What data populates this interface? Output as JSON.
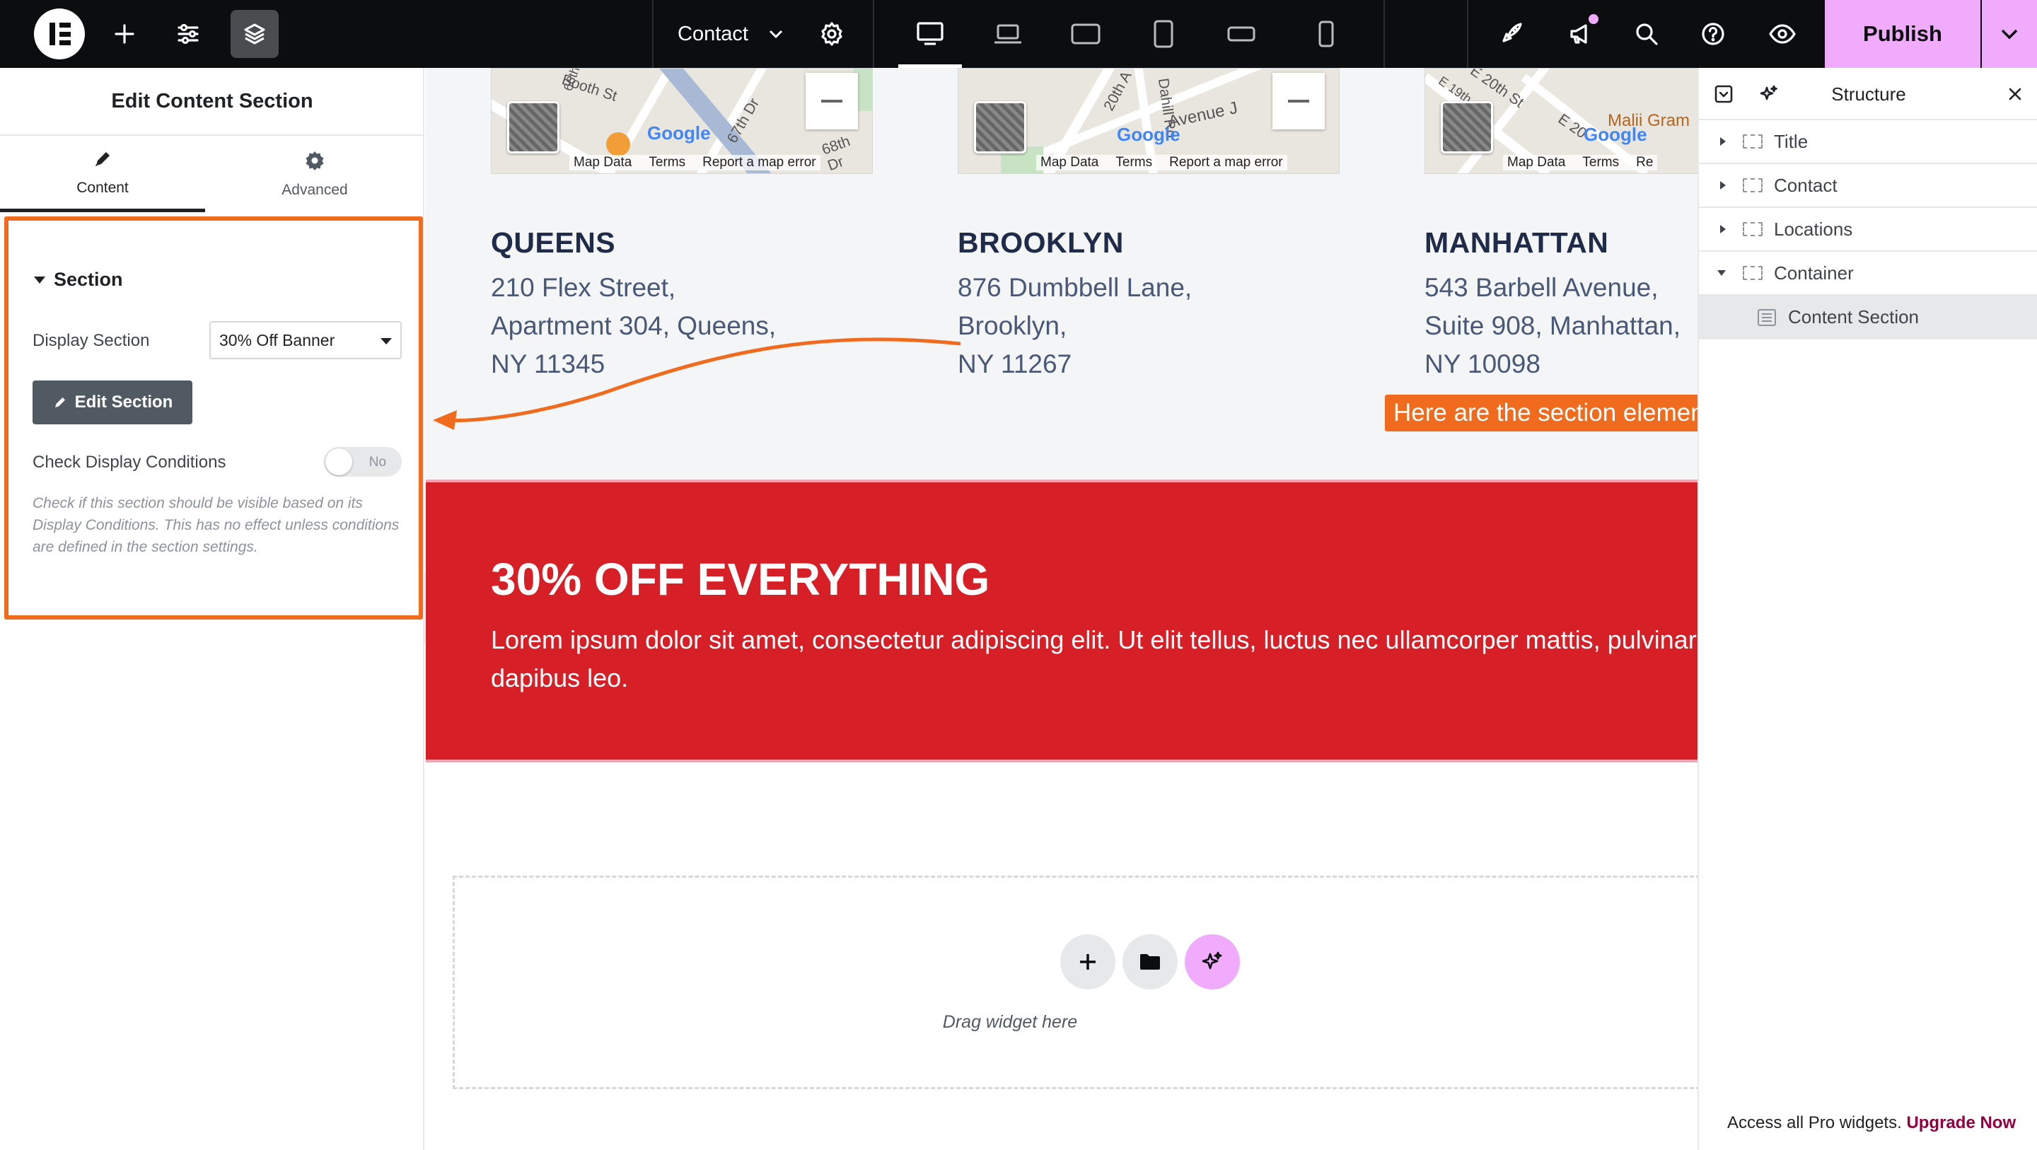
{
  "topbar": {
    "document_title": "Contact",
    "publish_label": "Publish",
    "icons": [
      "elementor-logo-icon",
      "add-icon",
      "settings-sliders-icon",
      "layers-icon",
      "chevron-down-icon",
      "gear-icon",
      "desktop-icon",
      "laptop-icon",
      "tablet-landscape-icon",
      "tablet-portrait-icon",
      "mobile-landscape-icon",
      "mobile-portrait-icon",
      "rocket-icon",
      "megaphone-icon",
      "search-icon",
      "help-icon",
      "eye-icon"
    ]
  },
  "left_panel": {
    "title": "Edit Content Section",
    "tabs": [
      {
        "label": "Content",
        "icon": "pencil-icon",
        "active": true
      },
      {
        "label": "Advanced",
        "icon": "gear-icon",
        "active": false
      }
    ],
    "section": {
      "heading": "Section",
      "display_section_label": "Display Section",
      "display_section_value": "30% Off Banner",
      "edit_button_label": "Edit Section",
      "check_conditions_label": "Check Display Conditions",
      "toggle_value": "No",
      "help_text": "Check if this section should be visible based on its Display Conditions. This has no effect unless conditions are defined in the section settings."
    }
  },
  "annotation": {
    "text": "Here are the section element settings",
    "color": "#f06b1e"
  },
  "canvas": {
    "maps": [
      {
        "street1": "66th",
        "street2": "Booth St",
        "street3": "67th Dr",
        "street4": "68th Dr",
        "brand": "Google",
        "footer": [
          "Map Data",
          "Terms",
          "Report a map error"
        ]
      },
      {
        "street1": "20th A",
        "street2": "Dahill Rd",
        "street3": "Avenue J",
        "street4": "",
        "brand": "Google",
        "footer": [
          "Map Data",
          "Terms",
          "Report a map error"
        ]
      },
      {
        "street1": "E 20th St",
        "street2": "E 19th",
        "street3": "E 20",
        "street4": "Malii Gram",
        "brand": "Google",
        "footer": [
          "Map Data",
          "Terms",
          "Re"
        ]
      }
    ],
    "locations": [
      {
        "name": "QUEENS",
        "address": [
          "210 Flex Street,",
          "Apartment 304, Queens,",
          "NY 11345"
        ]
      },
      {
        "name": "BROOKLYN",
        "address": [
          "876 Dumbbell Lane,",
          "Brooklyn,",
          "NY 11267"
        ]
      },
      {
        "name": "MANHATTAN",
        "address": [
          "543 Barbell Avenue,",
          "Suite 908, Manhattan,",
          "NY 10098"
        ]
      }
    ],
    "banner": {
      "title": "30% OFF EVERYTHING",
      "text": "Lorem ipsum dolor sit amet, consectetur adipiscing elit. Ut elit tellus, luctus nec ullamcorper mattis, pulvinar dapibus leo.",
      "bg_color": "#d61f26"
    },
    "drop_zone": {
      "text": "Drag widget here"
    }
  },
  "right_panel": {
    "title": "Structure",
    "items": [
      {
        "label": "Title",
        "expanded": false
      },
      {
        "label": "Contact",
        "expanded": false
      },
      {
        "label": "Locations",
        "expanded": false
      },
      {
        "label": "Container",
        "expanded": true
      },
      {
        "label": "Content Section",
        "expanded": false,
        "selected": true
      }
    ],
    "footer_text": "Access all Pro widgets.",
    "footer_link": "Upgrade Now"
  }
}
